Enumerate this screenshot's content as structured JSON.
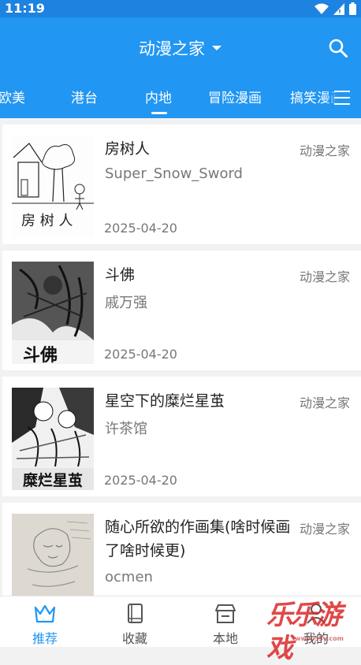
{
  "status_bar": {
    "time": "11:19",
    "icons": [
      "wifi-icon",
      "cellular-signal-icon",
      "battery-icon"
    ]
  },
  "header": {
    "title": "动漫之家",
    "icons": [
      "dropdown-triangle-icon",
      "search-icon"
    ]
  },
  "tabs": {
    "items": [
      {
        "label": "欧美"
      },
      {
        "label": "港台"
      },
      {
        "label": "内地",
        "selected": true
      },
      {
        "label": "冒险漫画"
      },
      {
        "label": "搞笑漫画"
      }
    ],
    "menu_icon": "hamburger-menu-icon"
  },
  "comics": [
    {
      "title": "房树人",
      "author": "Super_Snow_Sword",
      "date": "2025-04-20",
      "source": "动漫之家",
      "cover_text": "房 树 人"
    },
    {
      "title": "斗佛",
      "author": "戚万强",
      "date": "2025-04-20",
      "source": "动漫之家",
      "cover_text": "斗佛"
    },
    {
      "title": "星空下的糜烂星茧",
      "author": "许茶馆",
      "date": "2025-04-20",
      "source": "动漫之家",
      "cover_text": "糜烂星茧"
    },
    {
      "title": "随心所欲的作画集(啥时候画了啥时候更)",
      "author": "ocmen",
      "date": "",
      "source": "动漫之家"
    }
  ],
  "bottom_nav": {
    "items": [
      {
        "label": "推荐",
        "icon": "crown-icon",
        "active": true
      },
      {
        "label": "收藏",
        "icon": "book-icon"
      },
      {
        "label": "本地",
        "icon": "store-icon"
      },
      {
        "label": "我的",
        "icon": "person-icon"
      }
    ]
  },
  "watermark": {
    "text": "乐乐游戏",
    "sub": "www.55y.com"
  },
  "colors": {
    "primary": "#2196f3",
    "status_bar": "#1d82e0",
    "text_secondary": "#777777"
  }
}
